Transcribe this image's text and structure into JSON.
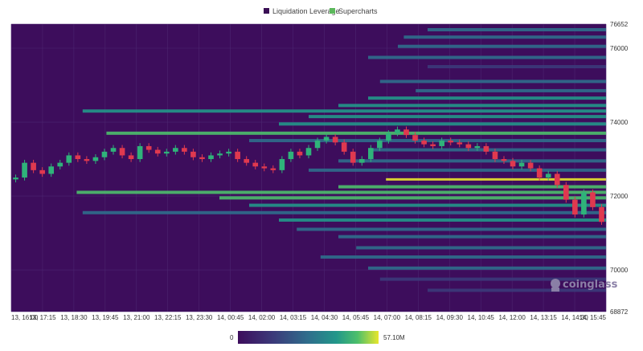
{
  "legend": [
    {
      "label": "Liquidation Leverage",
      "color": "#3a0f55"
    },
    {
      "label": "Supercharts",
      "color": "#5cb85c"
    }
  ],
  "watermark": "coinglass",
  "colors": {
    "background": "#3d0d5c",
    "grid": "#4c2670",
    "candle_up": "#2fb37a",
    "candle_down": "#e0394f",
    "scale": [
      "#3d0d5c",
      "#3b3a7a",
      "#2f6e8c",
      "#22978a",
      "#4cbf6b",
      "#e8e62d"
    ]
  },
  "chart_data": {
    "type": "heatmap",
    "title": "",
    "xlabel": "",
    "ylabel": "",
    "ylim": [
      68872,
      76652
    ],
    "y_ticks": [
      "76652",
      "76000",
      "74000",
      "72000",
      "70000",
      "68872"
    ],
    "x_ticks": [
      "13, 16:00",
      "13, 17:15",
      "13, 18:30",
      "13, 19:45",
      "13, 21:00",
      "13, 22:15",
      "13, 23:30",
      "14, 00:45",
      "14, 02:00",
      "14, 03:15",
      "14, 04:30",
      "14, 05:45",
      "14, 07:00",
      "14, 08:15",
      "14, 09:30",
      "14, 10:45",
      "14, 12:00",
      "14, 13:15",
      "14, 14:30",
      "14, 15:45"
    ],
    "colorscale": {
      "min_label": "0",
      "max_label": "57.10M"
    },
    "price_series_note": "",
    "price": [
      72.5,
      72.9,
      72.7,
      72.6,
      72.8,
      72.9,
      73.1,
      73.0,
      72.95,
      73.05,
      73.2,
      73.3,
      73.1,
      73.0,
      73.35,
      73.25,
      73.15,
      73.2,
      73.3,
      73.2,
      73.05,
      73.0,
      73.1,
      73.15,
      73.2,
      73.0,
      72.9,
      72.8,
      72.75,
      72.7,
      73.0,
      73.2,
      73.1,
      73.3,
      73.5,
      73.6,
      73.45,
      73.2,
      72.9,
      73.0,
      73.3,
      73.5,
      73.7,
      73.8,
      73.65,
      73.5,
      73.4,
      73.35,
      73.5,
      73.45,
      73.4,
      73.3,
      73.35,
      73.2,
      73.0,
      72.95,
      72.8,
      72.9,
      72.75,
      72.5,
      72.6,
      72.3,
      71.9,
      71.5,
      72.1,
      71.7,
      71.3
    ],
    "bands": [
      {
        "y": 76.5,
        "start": 0.7,
        "intensity": 0.35
      },
      {
        "y": 76.3,
        "start": 0.66,
        "intensity": 0.3
      },
      {
        "y": 76.05,
        "start": 0.65,
        "intensity": 0.3
      },
      {
        "y": 75.75,
        "start": 0.6,
        "intensity": 0.35
      },
      {
        "y": 75.5,
        "start": 0.7,
        "intensity": 0.25
      },
      {
        "y": 75.1,
        "start": 0.62,
        "intensity": 0.3
      },
      {
        "y": 74.85,
        "start": 0.68,
        "intensity": 0.45
      },
      {
        "y": 74.65,
        "start": 0.6,
        "intensity": 0.5
      },
      {
        "y": 74.45,
        "start": 0.55,
        "intensity": 0.55
      },
      {
        "y": 74.3,
        "start": 0.12,
        "intensity": 0.65
      },
      {
        "y": 74.15,
        "start": 0.5,
        "intensity": 0.55
      },
      {
        "y": 73.95,
        "start": 0.45,
        "intensity": 0.6
      },
      {
        "y": 73.7,
        "start": 0.16,
        "intensity": 0.75
      },
      {
        "y": 73.5,
        "start": 0.4,
        "intensity": 0.4
      },
      {
        "y": 73.25,
        "start": 0.6,
        "intensity": 0.35
      },
      {
        "y": 72.95,
        "start": 0.55,
        "intensity": 0.4
      },
      {
        "y": 72.7,
        "start": 0.5,
        "intensity": 0.45
      },
      {
        "y": 72.45,
        "start": 0.63,
        "intensity": 1.0
      },
      {
        "y": 72.25,
        "start": 0.55,
        "intensity": 0.7
      },
      {
        "y": 72.1,
        "start": 0.11,
        "intensity": 0.75
      },
      {
        "y": 71.95,
        "start": 0.35,
        "intensity": 0.8
      },
      {
        "y": 71.75,
        "start": 0.4,
        "intensity": 0.55
      },
      {
        "y": 71.55,
        "start": 0.12,
        "intensity": 0.45
      },
      {
        "y": 71.35,
        "start": 0.45,
        "intensity": 0.5
      },
      {
        "y": 71.1,
        "start": 0.48,
        "intensity": 0.45
      },
      {
        "y": 70.9,
        "start": 0.55,
        "intensity": 0.35
      },
      {
        "y": 70.6,
        "start": 0.58,
        "intensity": 0.3
      },
      {
        "y": 70.35,
        "start": 0.52,
        "intensity": 0.35
      },
      {
        "y": 70.05,
        "start": 0.6,
        "intensity": 0.3
      },
      {
        "y": 69.75,
        "start": 0.62,
        "intensity": 0.25
      },
      {
        "y": 69.45,
        "start": 0.7,
        "intensity": 0.25
      }
    ]
  }
}
